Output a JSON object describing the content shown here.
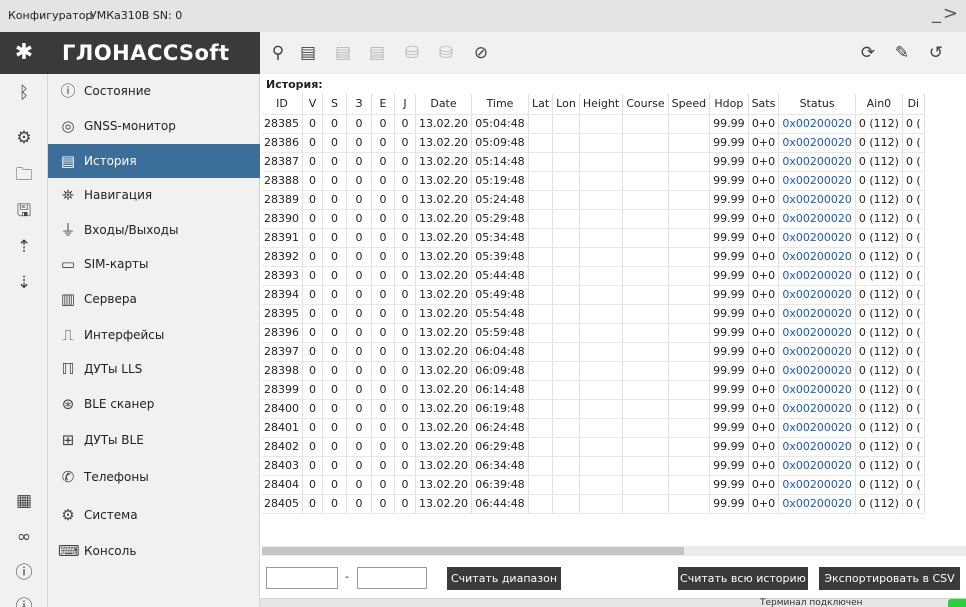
{
  "window": {
    "app_title": "Конфигуратор",
    "device": "УМКа310В SN: 0"
  },
  "brand": {
    "name": "ГЛОНАССSoft"
  },
  "rail": {
    "icons": [
      "bluetooth-icon",
      "usb-icon",
      "folder-icon",
      "save-icon",
      "upload-icon",
      "download-icon",
      "grid-icon",
      "link-icon",
      "help-icon",
      "info-icon"
    ]
  },
  "nav": {
    "items": [
      {
        "label": "Состояние",
        "icon": "info-icon"
      },
      {
        "label": "GNSS-монитор",
        "icon": "satellite-icon"
      },
      {
        "label": "История",
        "icon": "history-icon"
      },
      {
        "label": "Навигация",
        "icon": "navigation-icon"
      },
      {
        "label": "Входы/Выходы",
        "icon": "io-icon"
      },
      {
        "label": "SIM-карты",
        "icon": "sim-icon"
      },
      {
        "label": "Сервера",
        "icon": "server-icon"
      },
      {
        "label": "Интерфейсы",
        "icon": "interface-icon"
      },
      {
        "label": "ДУТы LLS",
        "icon": "fuel-sensor-icon"
      },
      {
        "label": "BLE сканер",
        "icon": "ble-icon"
      },
      {
        "label": "ДУТы BLE",
        "icon": "ble-sensor-icon"
      },
      {
        "label": "Телефоны",
        "icon": "phone-icon"
      },
      {
        "label": "Система",
        "icon": "gear-icon"
      },
      {
        "label": "Консоль",
        "icon": "console-icon"
      }
    ]
  },
  "history": {
    "title": "История:",
    "columns": [
      "ID",
      "V",
      "S",
      "З",
      "E",
      "J",
      "Date",
      "Time",
      "Lat",
      "Lon",
      "Height",
      "Course",
      "Speed",
      "Hdop",
      "Sats",
      "Status",
      "Ain0",
      "Di"
    ],
    "rows": [
      [
        "28385",
        "0",
        "0",
        "0",
        "0",
        "0",
        "13.02.20",
        "05:04:48",
        "",
        "",
        "",
        "",
        "",
        "99.99",
        "0+0",
        "0x00200020",
        "0 (112)",
        "0 ("
      ],
      [
        "28386",
        "0",
        "0",
        "0",
        "0",
        "0",
        "13.02.20",
        "05:09:48",
        "",
        "",
        "",
        "",
        "",
        "99.99",
        "0+0",
        "0x00200020",
        "0 (112)",
        "0 ("
      ],
      [
        "28387",
        "0",
        "0",
        "0",
        "0",
        "0",
        "13.02.20",
        "05:14:48",
        "",
        "",
        "",
        "",
        "",
        "99.99",
        "0+0",
        "0x00200020",
        "0 (112)",
        "0 ("
      ],
      [
        "28388",
        "0",
        "0",
        "0",
        "0",
        "0",
        "13.02.20",
        "05:19:48",
        "",
        "",
        "",
        "",
        "",
        "99.99",
        "0+0",
        "0x00200020",
        "0 (112)",
        "0 ("
      ],
      [
        "28389",
        "0",
        "0",
        "0",
        "0",
        "0",
        "13.02.20",
        "05:24:48",
        "",
        "",
        "",
        "",
        "",
        "99.99",
        "0+0",
        "0x00200020",
        "0 (112)",
        "0 ("
      ],
      [
        "28390",
        "0",
        "0",
        "0",
        "0",
        "0",
        "13.02.20",
        "05:29:48",
        "",
        "",
        "",
        "",
        "",
        "99.99",
        "0+0",
        "0x00200020",
        "0 (112)",
        "0 ("
      ],
      [
        "28391",
        "0",
        "0",
        "0",
        "0",
        "0",
        "13.02.20",
        "05:34:48",
        "",
        "",
        "",
        "",
        "",
        "99.99",
        "0+0",
        "0x00200020",
        "0 (112)",
        "0 ("
      ],
      [
        "28392",
        "0",
        "0",
        "0",
        "0",
        "0",
        "13.02.20",
        "05:39:48",
        "",
        "",
        "",
        "",
        "",
        "99.99",
        "0+0",
        "0x00200020",
        "0 (112)",
        "0 ("
      ],
      [
        "28393",
        "0",
        "0",
        "0",
        "0",
        "0",
        "13.02.20",
        "05:44:48",
        "",
        "",
        "",
        "",
        "",
        "99.99",
        "0+0",
        "0x00200020",
        "0 (112)",
        "0 ("
      ],
      [
        "28394",
        "0",
        "0",
        "0",
        "0",
        "0",
        "13.02.20",
        "05:49:48",
        "",
        "",
        "",
        "",
        "",
        "99.99",
        "0+0",
        "0x00200020",
        "0 (112)",
        "0 ("
      ],
      [
        "28395",
        "0",
        "0",
        "0",
        "0",
        "0",
        "13.02.20",
        "05:54:48",
        "",
        "",
        "",
        "",
        "",
        "99.99",
        "0+0",
        "0x00200020",
        "0 (112)",
        "0 ("
      ],
      [
        "28396",
        "0",
        "0",
        "0",
        "0",
        "0",
        "13.02.20",
        "05:59:48",
        "",
        "",
        "",
        "",
        "",
        "99.99",
        "0+0",
        "0x00200020",
        "0 (112)",
        "0 ("
      ],
      [
        "28397",
        "0",
        "0",
        "0",
        "0",
        "0",
        "13.02.20",
        "06:04:48",
        "",
        "",
        "",
        "",
        "",
        "99.99",
        "0+0",
        "0x00200020",
        "0 (112)",
        "0 ("
      ],
      [
        "28398",
        "0",
        "0",
        "0",
        "0",
        "0",
        "13.02.20",
        "06:09:48",
        "",
        "",
        "",
        "",
        "",
        "99.99",
        "0+0",
        "0x00200020",
        "0 (112)",
        "0 ("
      ],
      [
        "28399",
        "0",
        "0",
        "0",
        "0",
        "0",
        "13.02.20",
        "06:14:48",
        "",
        "",
        "",
        "",
        "",
        "99.99",
        "0+0",
        "0x00200020",
        "0 (112)",
        "0 ("
      ],
      [
        "28400",
        "0",
        "0",
        "0",
        "0",
        "0",
        "13.02.20",
        "06:19:48",
        "",
        "",
        "",
        "",
        "",
        "99.99",
        "0+0",
        "0x00200020",
        "0 (112)",
        "0 ("
      ],
      [
        "28401",
        "0",
        "0",
        "0",
        "0",
        "0",
        "13.02.20",
        "06:24:48",
        "",
        "",
        "",
        "",
        "",
        "99.99",
        "0+0",
        "0x00200020",
        "0 (112)",
        "0 ("
      ],
      [
        "28402",
        "0",
        "0",
        "0",
        "0",
        "0",
        "13.02.20",
        "06:29:48",
        "",
        "",
        "",
        "",
        "",
        "99.99",
        "0+0",
        "0x00200020",
        "0 (112)",
        "0 ("
      ],
      [
        "28403",
        "0",
        "0",
        "0",
        "0",
        "0",
        "13.02.20",
        "06:34:48",
        "",
        "",
        "",
        "",
        "",
        "99.99",
        "0+0",
        "0x00200020",
        "0 (112)",
        "0 ("
      ],
      [
        "28404",
        "0",
        "0",
        "0",
        "0",
        "0",
        "13.02.20",
        "06:39:48",
        "",
        "",
        "",
        "",
        "",
        "99.99",
        "0+0",
        "0x00200020",
        "0 (112)",
        "0 ("
      ],
      [
        "28405",
        "0",
        "0",
        "0",
        "0",
        "0",
        "13.02.20",
        "06:44:48",
        "",
        "",
        "",
        "",
        "",
        "99.99",
        "0+0",
        "0x00200020",
        "0 (112)",
        "0 ("
      ]
    ]
  },
  "controls": {
    "range_from": "",
    "range_to": "",
    "range_dash": "-",
    "read_range_label": "Считать диапазон",
    "read_all_label": "Считать всю историю",
    "export_csv_label": "Экспортировать в CSV"
  },
  "status": {
    "text": "Терминал подключен",
    "color": "#2ecc40"
  },
  "colors": {
    "active_nav": "#3b6e99",
    "status_link": "#1b57c2",
    "dark_bar": "#3a3a3a"
  }
}
